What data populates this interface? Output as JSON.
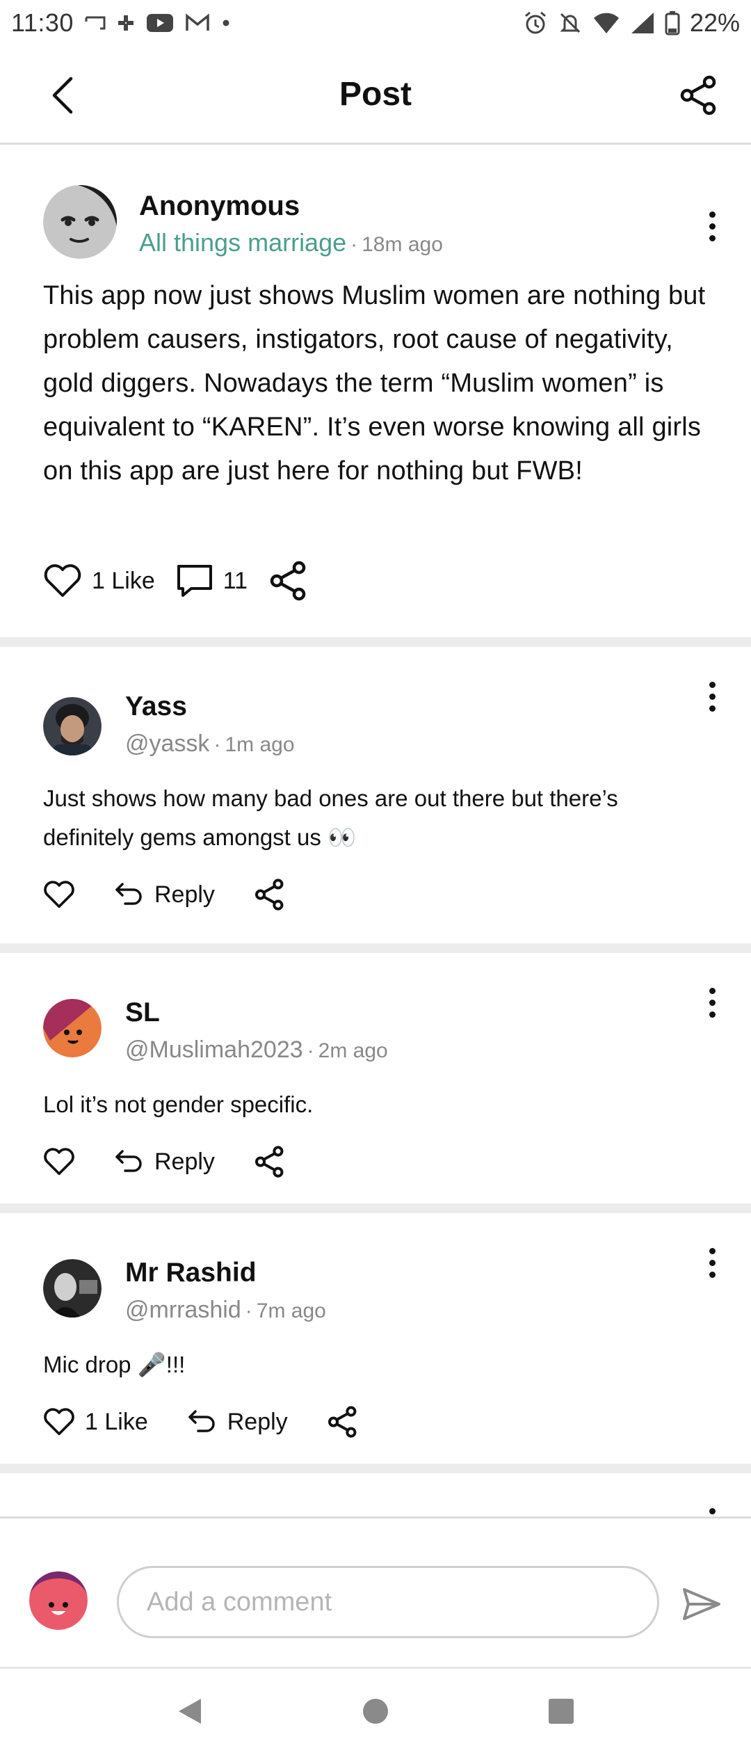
{
  "status_bar": {
    "time": "11:30",
    "battery": "22%"
  },
  "header": {
    "title": "Post"
  },
  "post": {
    "author": "Anonymous",
    "community": "All things marriage",
    "separator": "·",
    "time_ago": "18m ago",
    "body": "This app now just shows Muslim women are nothing but problem causers, instigators, root cause of negativity, gold diggers. Nowadays the term “Muslim women” is equivalent to “KAREN”. It’s even worse knowing all girls on this app are just here for nothing but FWB!",
    "likes_label": "1 Like",
    "comments_count": "11"
  },
  "comments": [
    {
      "name": "Yass",
      "handle": "@yassk",
      "separator": "·",
      "time_ago": "1m ago",
      "body": "Just shows how many bad ones are out there but there’s definitely gems amongst us 👀",
      "likes_label": "",
      "reply_label": "Reply"
    },
    {
      "name": "SL",
      "handle": "@Muslimah2023",
      "separator": "·",
      "time_ago": "2m ago",
      "body": "Lol it’s not gender specific.",
      "likes_label": "",
      "reply_label": "Reply"
    },
    {
      "name": "Mr Rashid",
      "handle": "@mrrashid",
      "separator": "·",
      "time_ago": "7m ago",
      "body": "Mic drop 🎤!!!",
      "likes_label": "1 Like",
      "reply_label": "Reply"
    }
  ],
  "composer": {
    "placeholder": "Add a comment"
  },
  "colors": {
    "accent_green": "#4a9e8e",
    "divider": "#ececec",
    "meta_gray": "#888888"
  }
}
